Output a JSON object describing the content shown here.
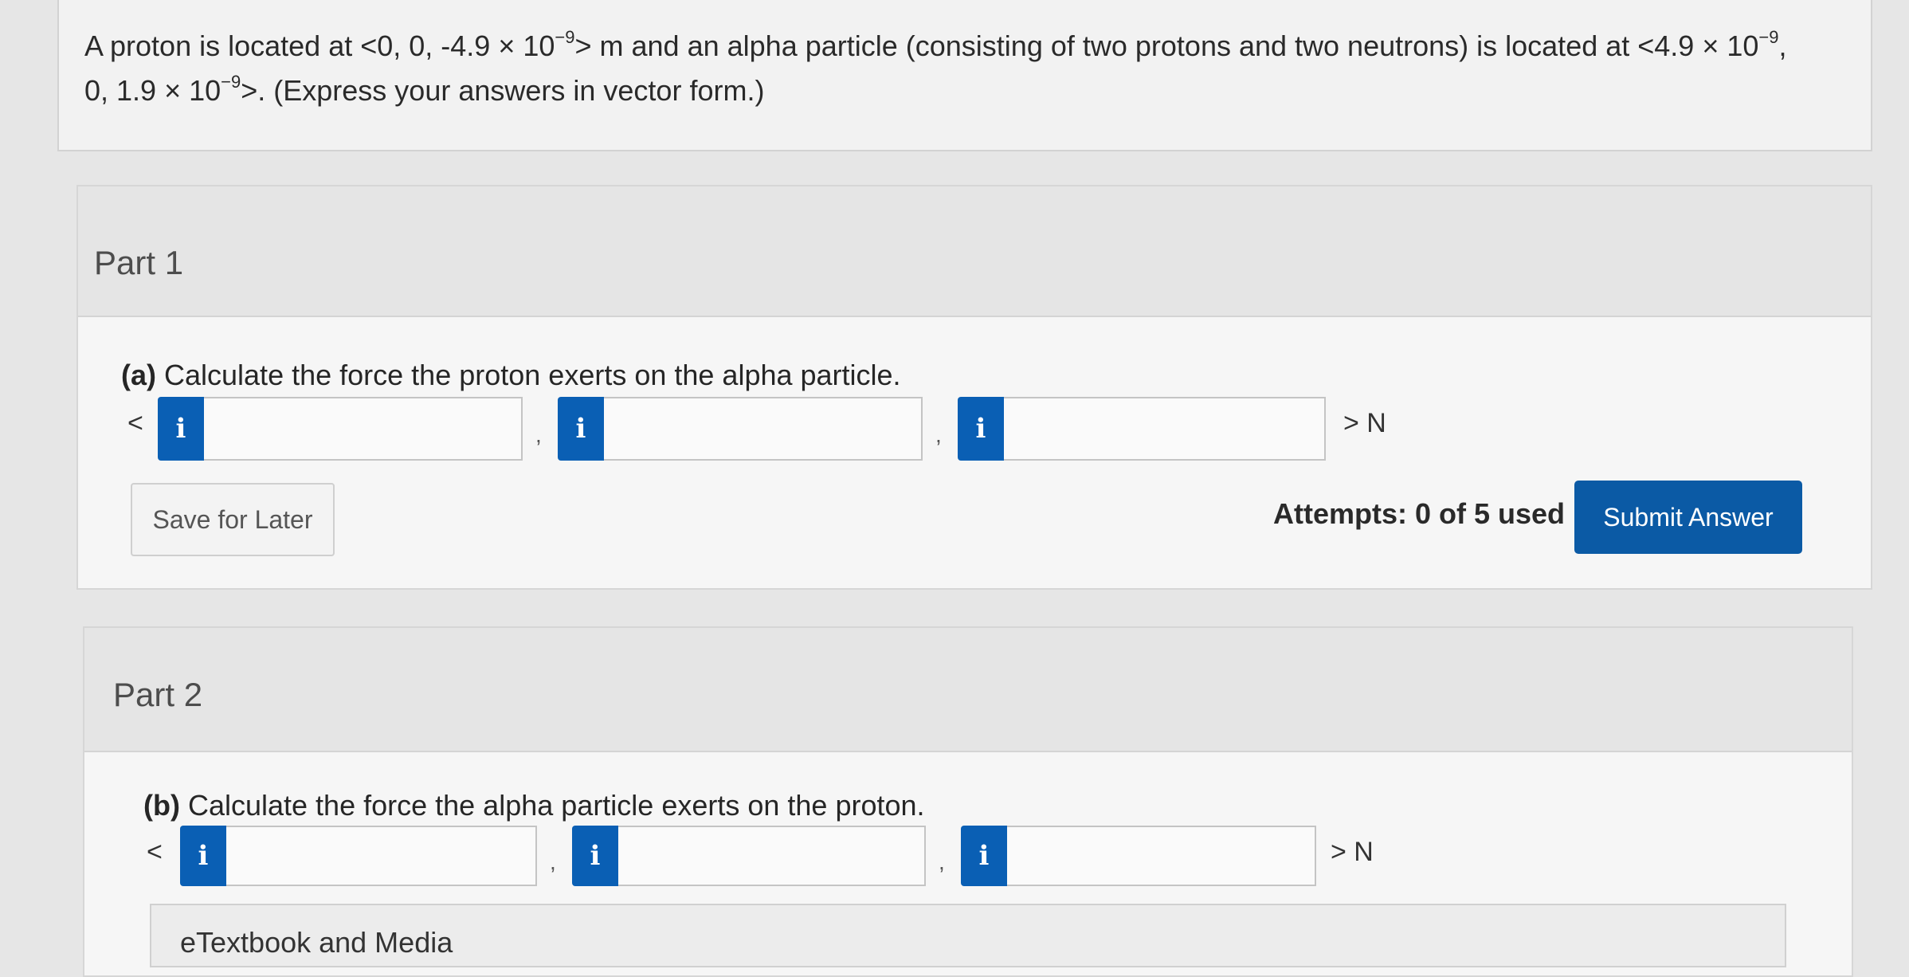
{
  "problem": {
    "seg1": "A proton is located at <0, 0, -4.9 × 10",
    "exp1": "−9",
    "seg2": "> m and an alpha particle (consisting of two protons and two neutrons) is located at <4.9 × 10",
    "exp2": "−9",
    "seg3": ",",
    "seg4": "0, 1.9 × 10",
    "exp3": "−9",
    "seg5": ">. (Express your answers in vector form.)"
  },
  "part1": {
    "title": "Part 1",
    "question_label": "(a)",
    "question_text": " Calculate the force the proton exerts on the alpha particle.",
    "open_bracket": "<",
    "separator": ",",
    "close_unit": "> N",
    "info_glyph": "i",
    "inputs": [
      {
        "value": ""
      },
      {
        "value": ""
      },
      {
        "value": ""
      }
    ],
    "save_label": "Save for Later",
    "attempts": "Attempts: 0 of 5 used",
    "submit_label": "Submit Answer"
  },
  "part2": {
    "title": "Part 2",
    "question_label": "(b)",
    "question_text": " Calculate the force the alpha particle exerts on the proton.",
    "open_bracket": "<",
    "separator": ",",
    "close_unit": "> N",
    "info_glyph": "i",
    "inputs": [
      {
        "value": ""
      },
      {
        "value": ""
      },
      {
        "value": ""
      }
    ]
  },
  "etextbook": {
    "label": "eTextbook and Media"
  },
  "colors": {
    "primary_button": "#0b5aa5",
    "info_button": "#0a5fb4"
  },
  "icons": {
    "info": "info-icon"
  }
}
